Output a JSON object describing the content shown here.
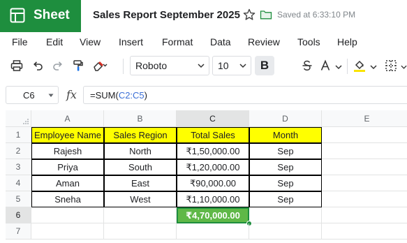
{
  "app": {
    "name": "Sheet",
    "brand_color": "#1e8e3e",
    "doc_title": "Sales Report September 2025",
    "save_status": "Saved at 6:33:10 PM"
  },
  "menu": [
    "File",
    "Edit",
    "View",
    "Insert",
    "Format",
    "Data",
    "Review",
    "Tools",
    "Help"
  ],
  "toolbar": {
    "font": "Roboto",
    "font_size": "10",
    "bold_active": true,
    "icons": [
      "print-icon",
      "undo-icon",
      "redo-icon",
      "paint-format-icon",
      "clear-format-icon",
      "bold-icon",
      "strikethrough-icon",
      "text-color-icon",
      "fill-color-icon",
      "borders-icon"
    ]
  },
  "formula_bar": {
    "cell_ref": "C6",
    "fx": "fx",
    "formula_prefix": "=SUM(",
    "formula_range": "C2:C5",
    "formula_suffix": ")"
  },
  "grid": {
    "columns": [
      "A",
      "B",
      "C",
      "D",
      "E"
    ],
    "rows": [
      "1",
      "2",
      "3",
      "4",
      "5",
      "6",
      "7"
    ],
    "header": [
      "Employee Name",
      "Sales Region",
      "Total Sales",
      "Month"
    ],
    "data": [
      [
        "Rajesh",
        "North",
        "₹1,50,000.00",
        "Sep"
      ],
      [
        "Priya",
        "South",
        "₹1,20,000.00",
        "Sep"
      ],
      [
        "Aman",
        "East",
        "₹90,000.00",
        "Sep"
      ],
      [
        "Sneha",
        "West",
        "₹1,10,000.00",
        "Sep"
      ]
    ],
    "total": "₹4,70,000.00",
    "header_fill": "#ffff00",
    "selected_fill": "#5fb847"
  }
}
